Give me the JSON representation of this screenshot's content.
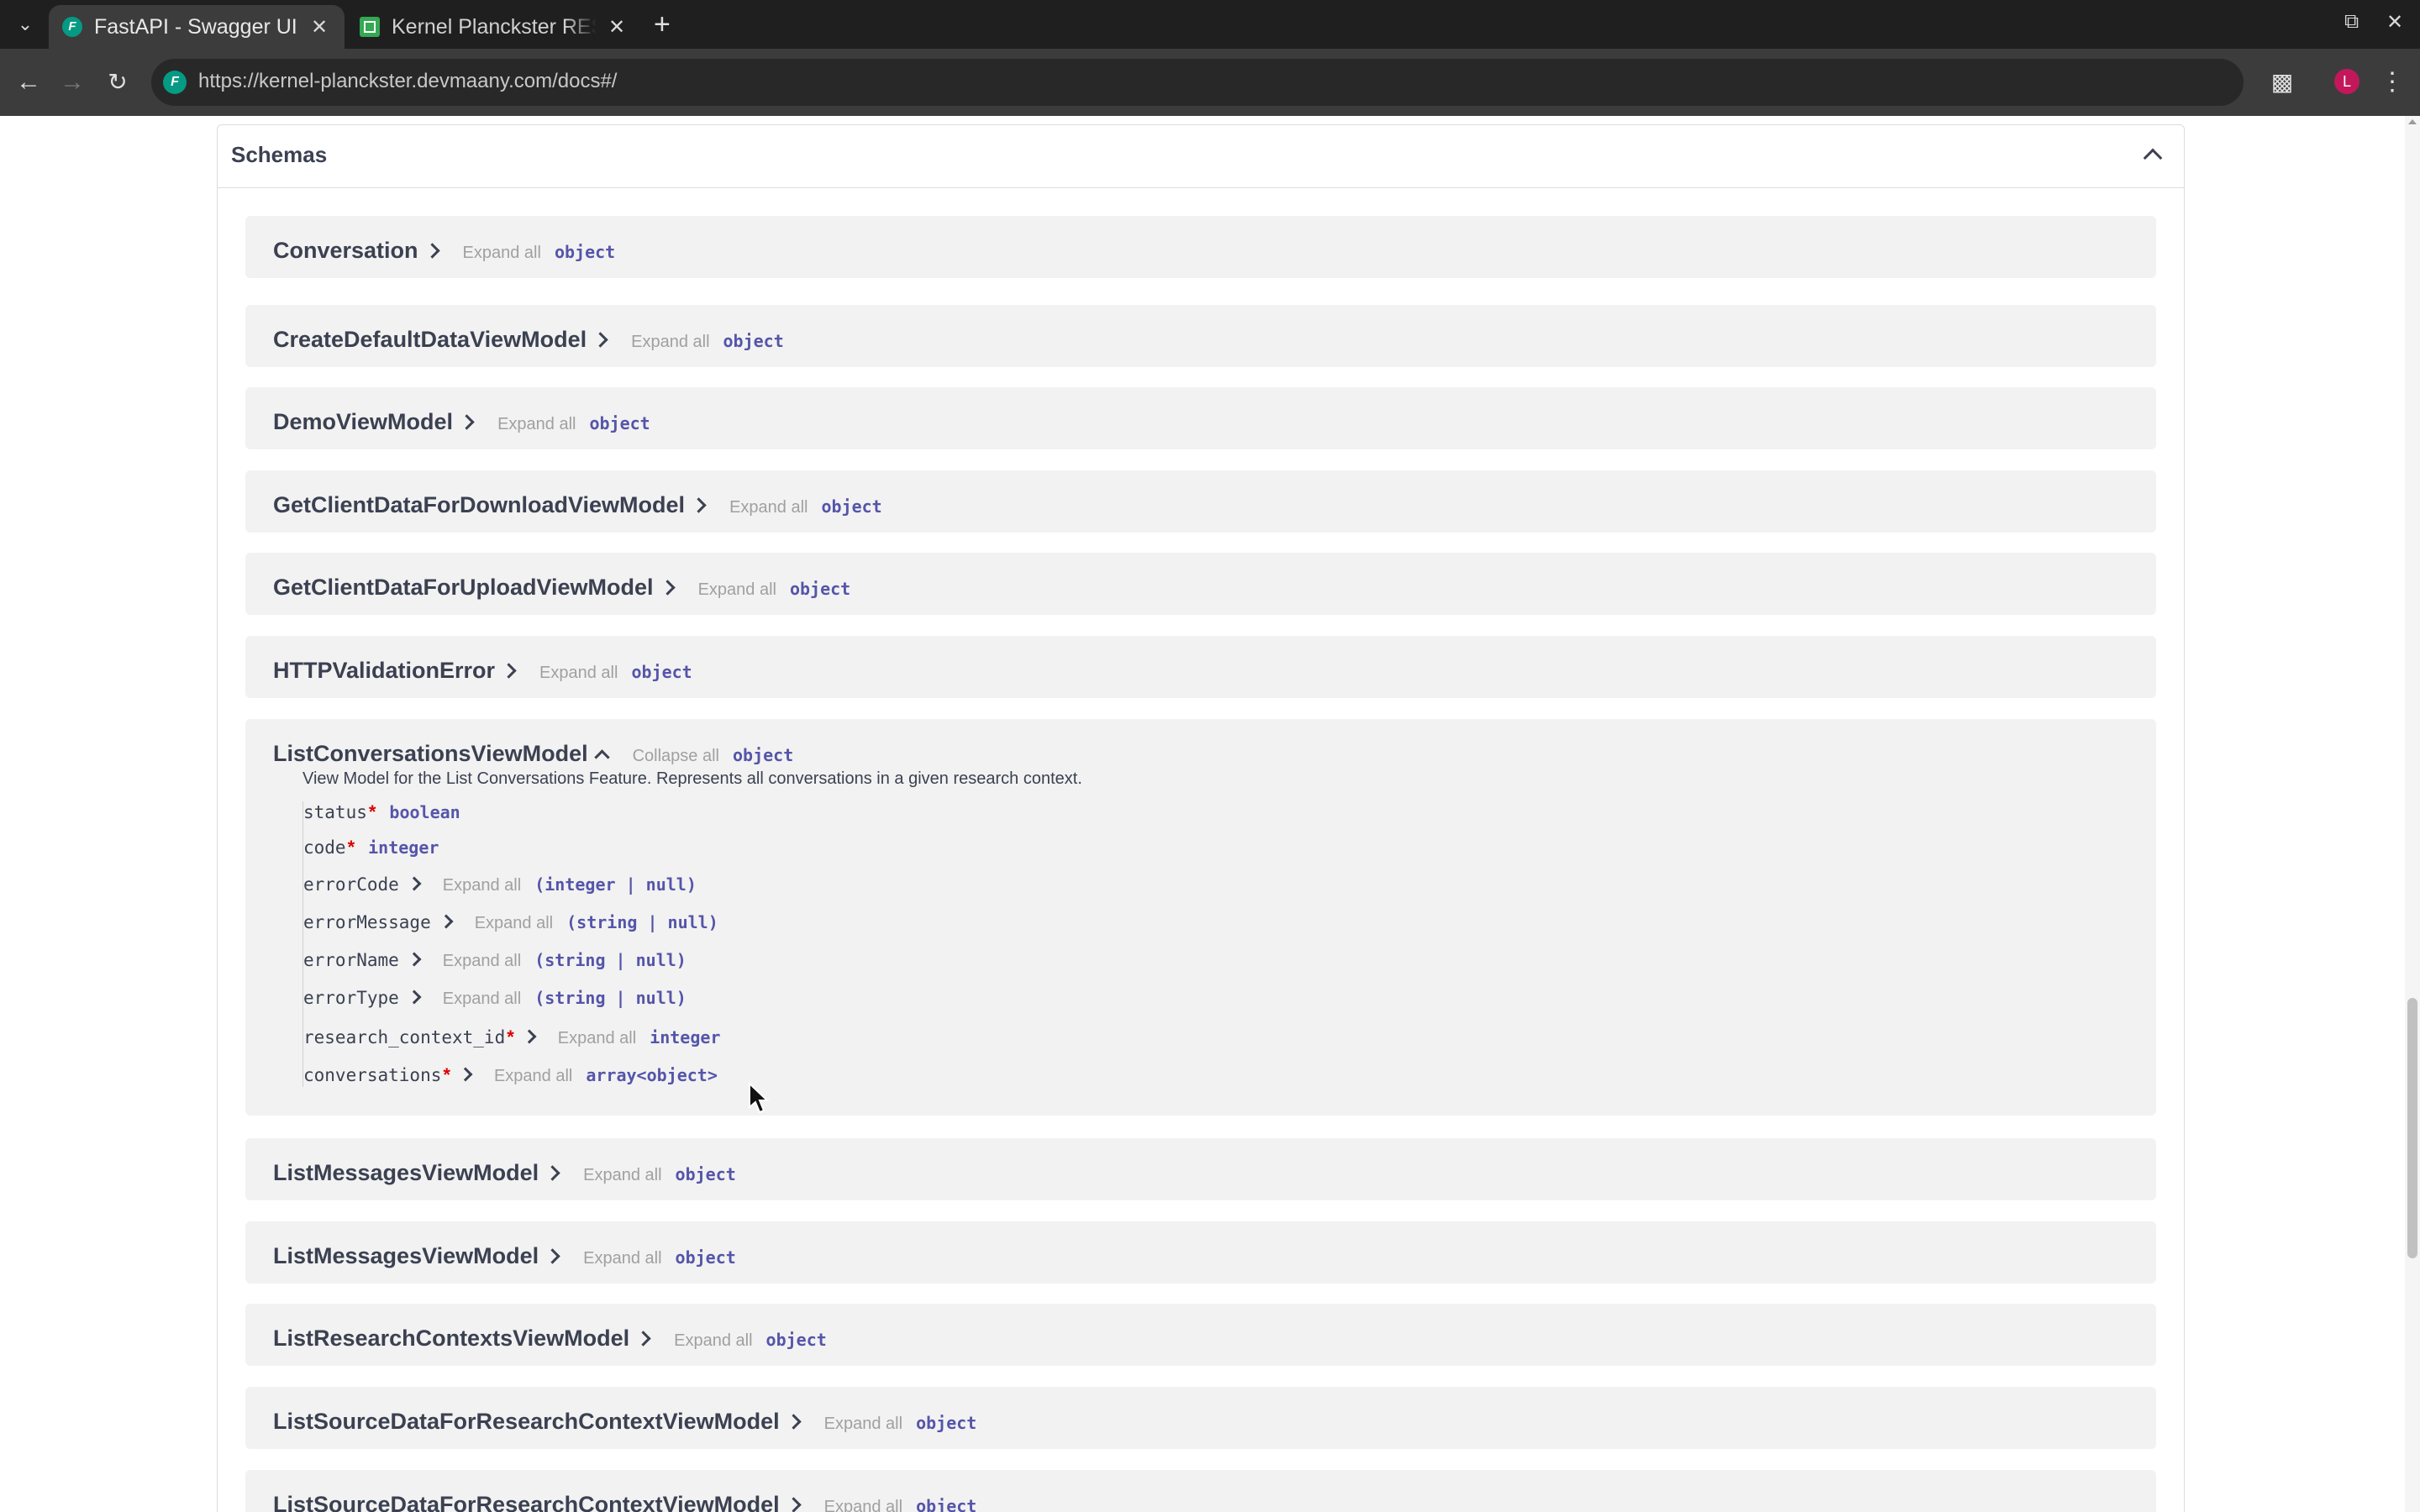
{
  "browser": {
    "tabs": [
      {
        "title": "FastAPI - Swagger UI",
        "active": true
      },
      {
        "title": "Kernel Planckster RES",
        "active": false
      }
    ],
    "url": "https://kernel-planckster.devmaany.com/docs#/",
    "profile_initial": "L"
  },
  "schemas": {
    "title": "Schemas",
    "models": [
      {
        "name": "Conversation",
        "action": "Expand all",
        "type": "object"
      },
      {
        "name": "CreateDefaultDataViewModel",
        "action": "Expand all",
        "type": "object"
      },
      {
        "name": "DemoViewModel",
        "action": "Expand all",
        "type": "object"
      },
      {
        "name": "GetClientDataForDownloadViewModel",
        "action": "Expand all",
        "type": "object"
      },
      {
        "name": "GetClientDataForUploadViewModel",
        "action": "Expand all",
        "type": "object"
      },
      {
        "name": "HTTPValidationError",
        "action": "Expand all",
        "type": "object"
      },
      {
        "name": "ListConversationsViewModel",
        "action": "Collapse all",
        "type": "object",
        "expanded": true,
        "description": "View Model for the List Conversations Feature. Represents all conversations in a given research context.",
        "properties": [
          {
            "name": "status",
            "required": true,
            "type": "boolean"
          },
          {
            "name": "code",
            "required": true,
            "type": "integer"
          },
          {
            "name": "errorCode",
            "required": false,
            "action": "Expand all",
            "type": "(integer | null)"
          },
          {
            "name": "errorMessage",
            "required": false,
            "action": "Expand all",
            "type": "(string | null)"
          },
          {
            "name": "errorName",
            "required": false,
            "action": "Expand all",
            "type": "(string | null)"
          },
          {
            "name": "errorType",
            "required": false,
            "action": "Expand all",
            "type": "(string | null)"
          },
          {
            "name": "research_context_id",
            "required": true,
            "action": "Expand all",
            "type": "integer"
          },
          {
            "name": "conversations",
            "required": true,
            "action": "Expand all",
            "type": "array<object>"
          }
        ]
      },
      {
        "name": "ListMessagesViewModel",
        "action": "Expand all",
        "type": "object"
      },
      {
        "name": "ListMessagesViewModel",
        "action": "Expand all",
        "type": "object"
      },
      {
        "name": "ListResearchContextsViewModel",
        "action": "Expand all",
        "type": "object"
      },
      {
        "name": "ListSourceDataForResearchContextViewModel",
        "action": "Expand all",
        "type": "object"
      },
      {
        "name": "ListSourceDataForResearchContextViewModel",
        "action": "Expand all",
        "type": "object"
      }
    ],
    "required_mark": "*"
  },
  "colors": {
    "type_text": "#5555aa",
    "required": "#dd0000",
    "model_bg": "#f2f2f2"
  }
}
